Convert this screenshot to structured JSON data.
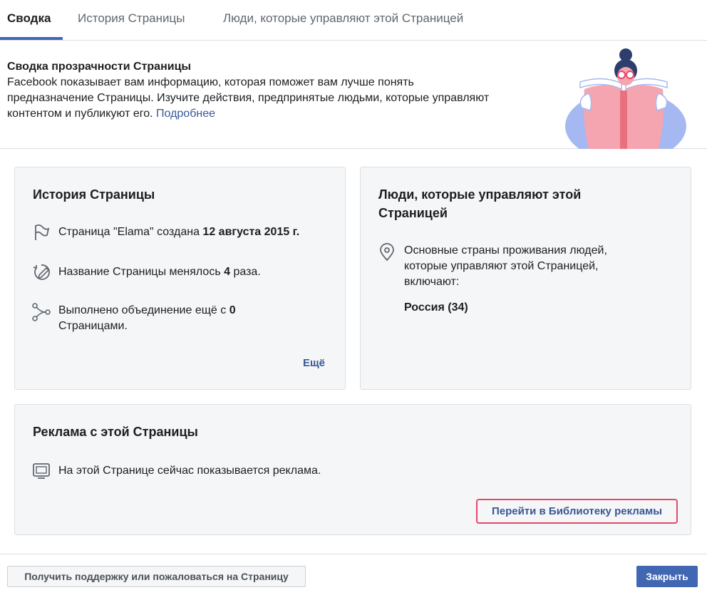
{
  "tabs": [
    {
      "label": "Сводка",
      "active": true
    },
    {
      "label": "История Страницы",
      "active": false
    },
    {
      "label": "Люди, которые управляют этой Страницей",
      "active": false
    }
  ],
  "summary": {
    "title": "Сводка прозрачности Страницы",
    "text": "Facebook показывает вам информацию, которая поможет вам лучше понять предназначение Страницы. Изучите действия, предпринятые людьми, которые управляют контентом и публикуют его.",
    "more_link": "Подробнее",
    "illustration_icon": "person-reading-book-illustration"
  },
  "page_history": {
    "title": "История Страницы",
    "items": [
      {
        "icon": "flag-icon",
        "text_before": "Страница \"Elama\" создана ",
        "text_bold": "12 августа 2015 г."
      },
      {
        "icon": "edit-history-icon",
        "text_before": "Название Страницы менялось ",
        "text_bold": "4",
        "text_after": " раза."
      },
      {
        "icon": "merge-icon",
        "line1_before": "Выполнено объединение ещё с ",
        "line1_bold": "0",
        "line2": "Страницами."
      }
    ],
    "more_label": "Ещё"
  },
  "people": {
    "title_line1": "Люди, которые управляют этой",
    "title_line2": "Страницей",
    "icon": "location-pin-icon",
    "desc_lines": [
      "Основные страны проживания людей,",
      "которые управляют этой Страницей,",
      "включают:"
    ],
    "country": "Россия (34)"
  },
  "ads": {
    "title": "Реклама с этой Страницы",
    "icon": "monitor-icon",
    "text": "На этой Странице сейчас показывается реклама.",
    "library_button": "Перейти в Библиотеку рекламы"
  },
  "footer": {
    "support_button": "Получить поддержку или пожаловаться на Страницу",
    "close_button": "Закрыть"
  },
  "colors": {
    "accent": "#4267b2",
    "link": "#385898",
    "highlight": "#e8476b",
    "card_bg": "#f5f6f7"
  }
}
